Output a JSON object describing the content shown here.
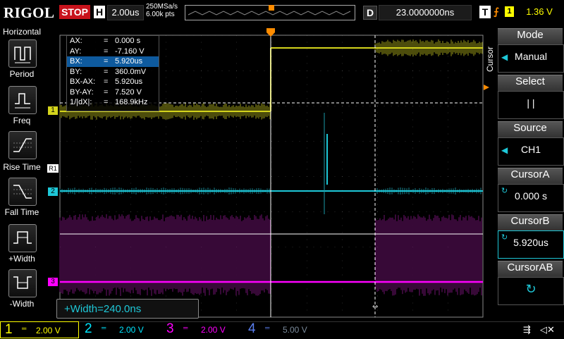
{
  "top": {
    "brand": "RIGOL",
    "run_state": "STOP",
    "h_label": "H",
    "timebase": "2.00us",
    "sample_rate": "250MSa/s",
    "points": "6.00k pts",
    "d_label": "D",
    "delay": "23.0000000ns",
    "t_label": "T",
    "trigger_source": "1",
    "trigger_level": "1.36 V"
  },
  "left_panel": {
    "title": "Horizontal",
    "items": [
      "Period",
      "Freq",
      "Rise Time",
      "Fall Time",
      "+Width",
      "-Width"
    ]
  },
  "cursor_readout": {
    "rows": [
      {
        "label": "AX:",
        "eq": "=",
        "value": "0.000 s"
      },
      {
        "label": "AY:",
        "eq": "=",
        "value": "-7.160 V"
      },
      {
        "label": "BX:",
        "eq": "=",
        "value": "5.920us"
      },
      {
        "label": "BY:",
        "eq": "=",
        "value": "360.0mV"
      },
      {
        "label": "BX-AX:",
        "eq": "=",
        "value": "5.920us"
      },
      {
        "label": "BY-AY:",
        "eq": "=",
        "value": "7.520 V"
      },
      {
        "label": "1/|dX|:",
        "eq": "=",
        "value": "168.9kHz"
      }
    ]
  },
  "measurement": "+Width=240.0ns",
  "right_panel": {
    "side_label": "Cursor",
    "mode": {
      "title": "Mode",
      "value": "Manual"
    },
    "select": {
      "title": "Select",
      "value": "|    |"
    },
    "source": {
      "title": "Source",
      "value": "CH1"
    },
    "cursor_a": {
      "title": "CursorA",
      "value": "0.000 s"
    },
    "cursor_b": {
      "title": "CursorB",
      "value": "5.920us"
    },
    "cursor_ab": {
      "title": "CursorAB",
      "value": ""
    }
  },
  "channel_markers": {
    "ch1": "1",
    "ch2": "2",
    "ch3": "3",
    "ref": "R1"
  },
  "channels": [
    {
      "num": "1",
      "scale": "2.00 V",
      "color": "#ffff00"
    },
    {
      "num": "2",
      "scale": "2.00 V",
      "color": "#00e5ff"
    },
    {
      "num": "3",
      "scale": "2.00 V",
      "color": "#ff00ff"
    },
    {
      "num": "4",
      "scale": "5.00 V",
      "color": "#5a7ff0"
    }
  ],
  "colors": {
    "ch1": "#d4d41c",
    "ch2": "#1ec8d8",
    "ch3": "#b41cb4",
    "ch4": "#5a7ff0",
    "accent": "#ff8c00"
  }
}
